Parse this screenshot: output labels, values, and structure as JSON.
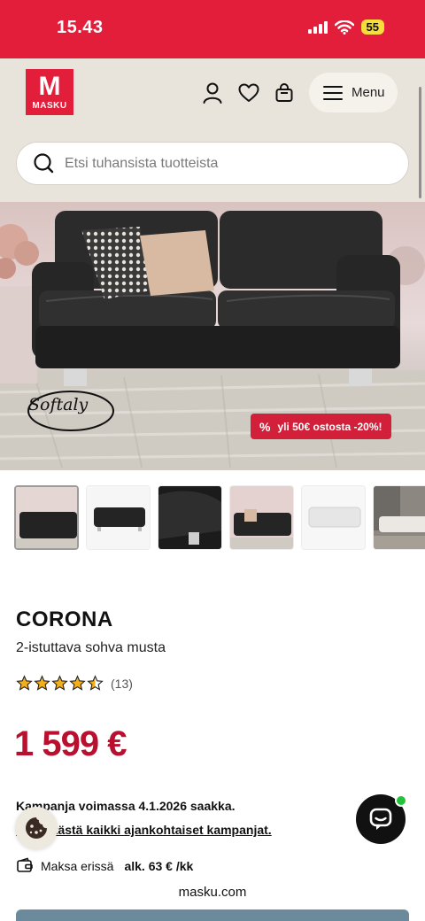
{
  "status_bar": {
    "time": "15.43",
    "battery": "55"
  },
  "header": {
    "logo_text": "MASKU",
    "menu_label": "Menu",
    "icons": [
      "user-icon",
      "heart-icon",
      "bag-icon",
      "hamburger-icon"
    ]
  },
  "search": {
    "placeholder": "Etsi tuhansista tuotteista"
  },
  "hero": {
    "brand": "Softaly",
    "promo": "yli 50€ ostosta -20%!",
    "promo_icon": "percent-icon"
  },
  "thumbnails": [
    {
      "name": "thumb-1",
      "active": true
    },
    {
      "name": "thumb-2",
      "active": false
    },
    {
      "name": "thumb-3",
      "active": false
    },
    {
      "name": "thumb-4",
      "active": false
    },
    {
      "name": "thumb-5",
      "active": false
    },
    {
      "name": "thumb-6",
      "active": false
    }
  ],
  "product": {
    "name": "CORONA",
    "description": "2-istuttava sohva musta",
    "rating": 4.5,
    "review_count": "(13)",
    "price": "1 599 €",
    "campaign_text": "Kampanja voimassa 4.1.2026 saakka.",
    "campaign_link": "Katso tästä kaikki ajankohtaiset kampanjat.",
    "payment_label": "Maksa erissä",
    "payment_amount": "alk. 63 € /kk"
  },
  "browser": {
    "url": "masku.com"
  },
  "colors": {
    "brand_red": "#e31e3b",
    "price_red": "#b8102e",
    "header_bg": "#e9e4db",
    "online_green": "#22c33a"
  }
}
